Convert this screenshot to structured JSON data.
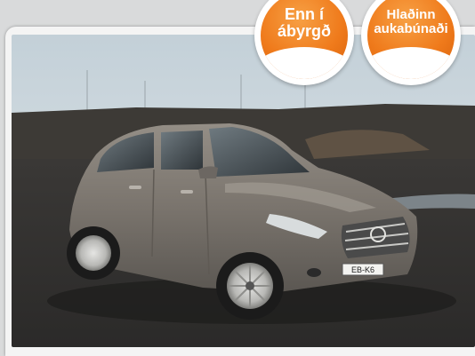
{
  "badges": [
    {
      "line1": "Enn í",
      "line2": "ábyrgð"
    },
    {
      "line1": "Hlaðinn",
      "line2": "aukabúnaði"
    }
  ],
  "car": {
    "plate_text": "EB-K6"
  },
  "colors": {
    "badge_orange": "#ef7a1b",
    "frame_grey": "#d9dadb",
    "car_grey": "#7b7670"
  }
}
